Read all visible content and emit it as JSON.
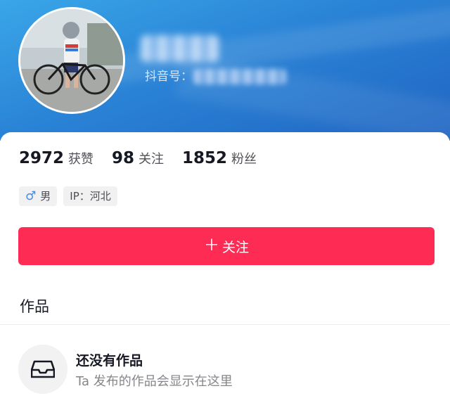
{
  "profile": {
    "nickname": "",
    "id_label": "抖音号：",
    "id_value": ""
  },
  "stats": [
    {
      "value": "2972",
      "label": "获赞"
    },
    {
      "value": "98",
      "label": "关注"
    },
    {
      "value": "1852",
      "label": "粉丝"
    }
  ],
  "tags": {
    "gender_icon": "♂",
    "gender": "男",
    "ip": "IP：河北"
  },
  "follow_button": {
    "icon": "＋",
    "label": "关注"
  },
  "works": {
    "title": "作品",
    "empty_title": "还没有作品",
    "empty_subtitle": "Ta 发布的作品会显示在这里",
    "empty_icon": "inbox-icon"
  },
  "colors": {
    "accent": "#fe2c55",
    "header": "#2a83d6"
  }
}
